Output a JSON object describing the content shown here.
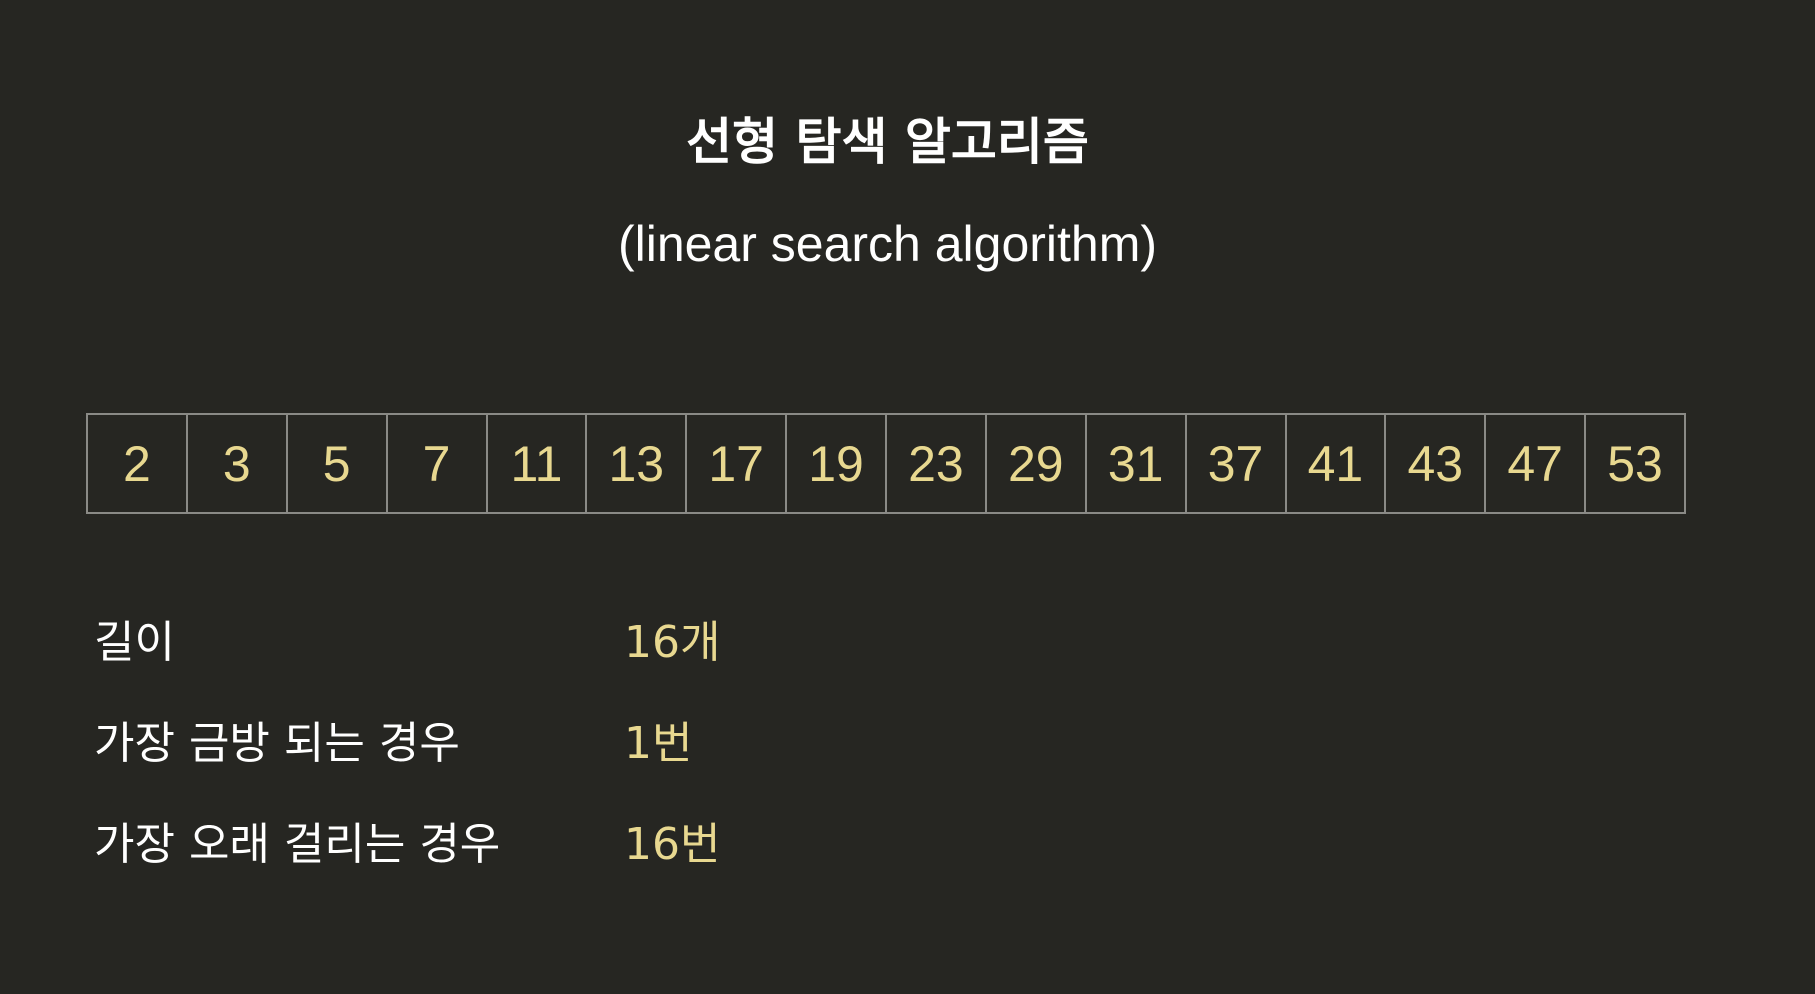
{
  "title": "선형 탐색 알고리즘",
  "subtitle": "(linear search algorithm)",
  "array": {
    "values": [
      "2",
      "3",
      "5",
      "7",
      "11",
      "13",
      "17",
      "19",
      "23",
      "29",
      "31",
      "37",
      "41",
      "43",
      "47",
      "53"
    ]
  },
  "info": [
    {
      "label": "길이",
      "value": "16개"
    },
    {
      "label": "가장 금방 되는 경우",
      "value": "1번"
    },
    {
      "label": "가장 오래 걸리는 경우",
      "value": "16번"
    }
  ],
  "colors": {
    "background": "#262622",
    "text": "#ffffff",
    "accent": "#e8d890",
    "border": "#8a8a86"
  }
}
